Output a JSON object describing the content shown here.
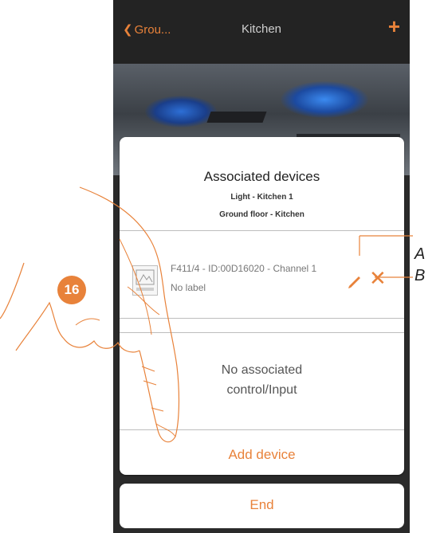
{
  "nav": {
    "back_label": "Grou...",
    "title": "Kitchen",
    "add_label": "+"
  },
  "card": {
    "title": "Associated devices",
    "subtitle_line1": "Light - Kitchen 1",
    "subtitle_line2": "Ground floor - Kitchen",
    "device": {
      "name": "F411/4 - ID:00D16020 - Channel 1",
      "label": "No label"
    },
    "no_assoc_line1": "No associated",
    "no_assoc_line2": "control/Input",
    "add_device_label": "Add device"
  },
  "end_button": {
    "label": "End"
  },
  "annotations": {
    "step_number": "16",
    "callout_a": "A",
    "callout_b": "B"
  },
  "colors": {
    "accent": "#e8823a",
    "navbar": "#232323"
  }
}
